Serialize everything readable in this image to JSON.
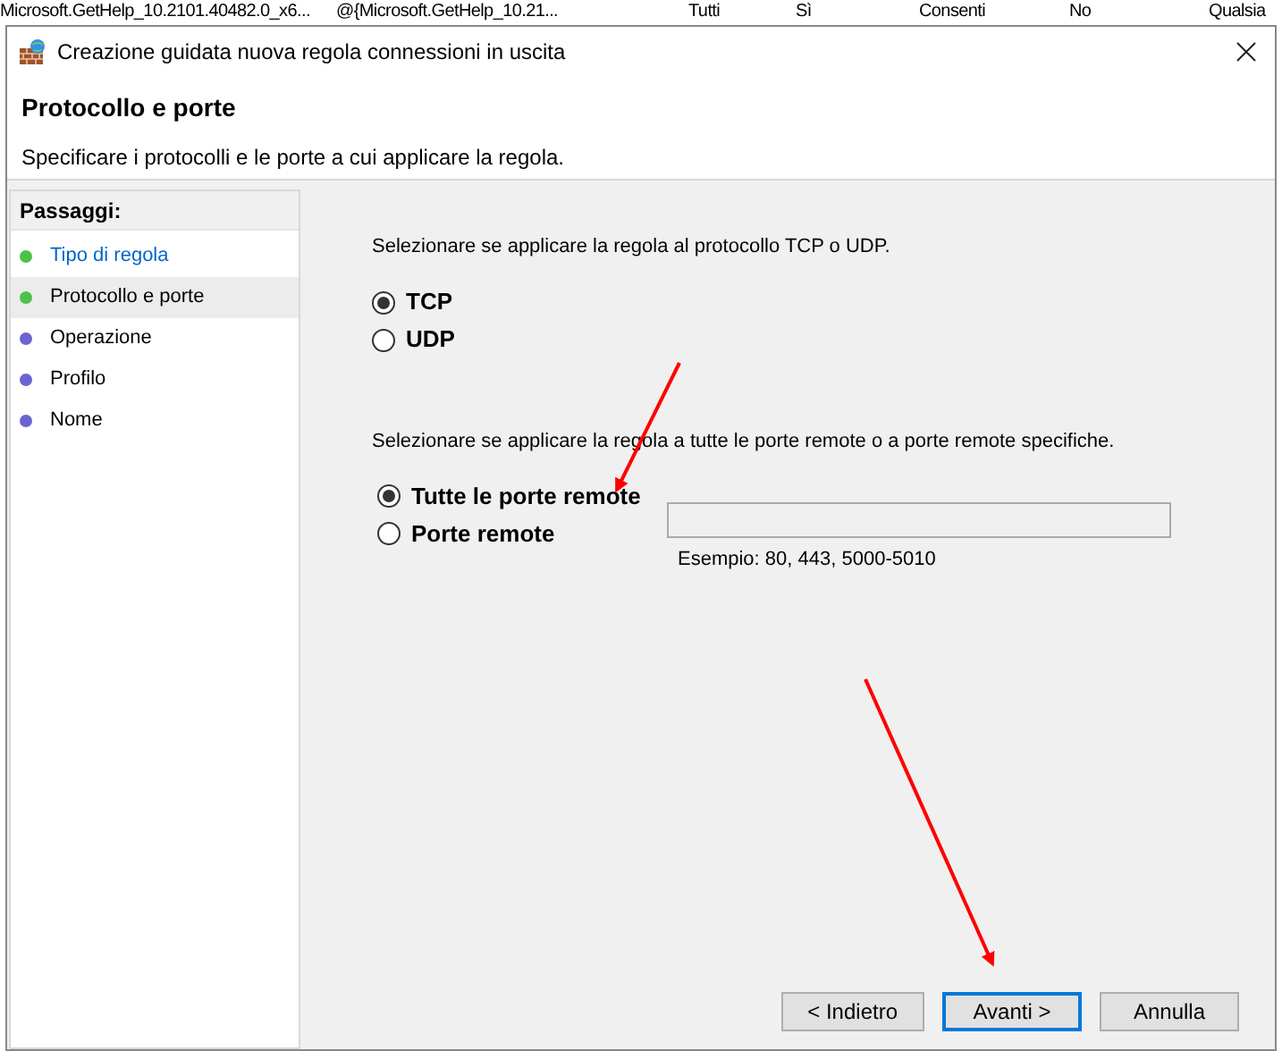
{
  "background_row": [
    "Microsoft.GetHelp_10.2101.40482.0_x6...",
    "@{Microsoft.GetHelp_10.21...",
    "Tutti",
    "Sì",
    "Consenti",
    "No",
    "Qualsia"
  ],
  "window": {
    "title": "Creazione guidata nuova regola connessioni in uscita"
  },
  "header": {
    "title": "Protocollo e porte",
    "subtitle": "Specificare i protocolli e le porte a cui applicare la regola."
  },
  "steps": {
    "title": "Passaggi:",
    "items": [
      {
        "label": "Tipo di regola",
        "selected": false,
        "link": true,
        "color": "#4cc24a"
      },
      {
        "label": "Protocollo e porte",
        "selected": true,
        "link": false,
        "color": "#4cc24a"
      },
      {
        "label": "Operazione",
        "selected": false,
        "link": false,
        "color": "#6a64d0"
      },
      {
        "label": "Profilo",
        "selected": false,
        "link": false,
        "color": "#6a64d0"
      },
      {
        "label": "Nome",
        "selected": false,
        "link": false,
        "color": "#6a64d0"
      }
    ]
  },
  "protocol": {
    "prompt": "Selezionare se applicare la regola al protocollo TCP o UDP.",
    "options": [
      {
        "label": "TCP",
        "selected": true
      },
      {
        "label": "UDP",
        "selected": false
      }
    ]
  },
  "ports": {
    "prompt": "Selezionare se applicare la regola a tutte le porte remote o a porte remote specifiche.",
    "options": [
      {
        "label": "Tutte le porte remote",
        "selected": true
      },
      {
        "label": "Porte remote",
        "selected": false
      }
    ],
    "example": "Esempio: 80, 443, 5000-5010"
  },
  "buttons": [
    {
      "label": "< Indietro",
      "focused": false
    },
    {
      "label": "Avanti >",
      "focused": true
    },
    {
      "label": "Annulla",
      "focused": false
    }
  ]
}
